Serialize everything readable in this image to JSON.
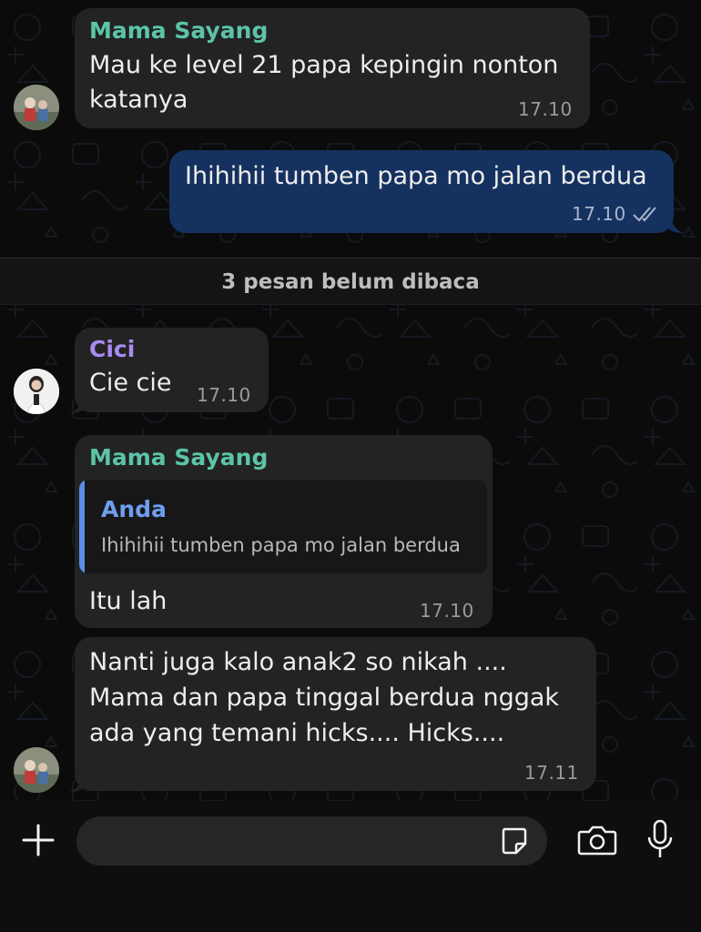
{
  "colors": {
    "incoming_bubble": "#232323",
    "outgoing_bubble": "#15315f",
    "sender_mama": "#5cc4a8",
    "sender_cici": "#a88bf2",
    "quote_accent": "#5b8ee8"
  },
  "messages": [
    {
      "sender": "Mama Sayang",
      "lines": [
        "Mau ke level 21 papa kepingin nonton",
        "katanya"
      ],
      "time": "17.10"
    },
    {
      "text": "Ihihihii tumben papa mo jalan berdua",
      "time": "17.10",
      "status_icon": "double-check-icon"
    },
    {
      "sender": "Cici",
      "text": "Cie cie",
      "time": "17.10"
    },
    {
      "sender": "Mama Sayang",
      "quote": {
        "name": "Anda",
        "text": "Ihihihii tumben papa mo jalan berdua"
      },
      "text": "Itu lah",
      "time": "17.10"
    },
    {
      "lines": [
        "Nanti juga kalo anak2 so nikah ....",
        "Mama dan papa tinggal berdua nggak",
        "ada yang temani hicks.... Hicks...."
      ],
      "time": "17.11"
    }
  ],
  "unread_divider": "3 pesan belum dibaca",
  "input_bar": {
    "icons": [
      "plus-icon",
      "sticker-icon",
      "camera-icon",
      "microphone-icon"
    ]
  }
}
